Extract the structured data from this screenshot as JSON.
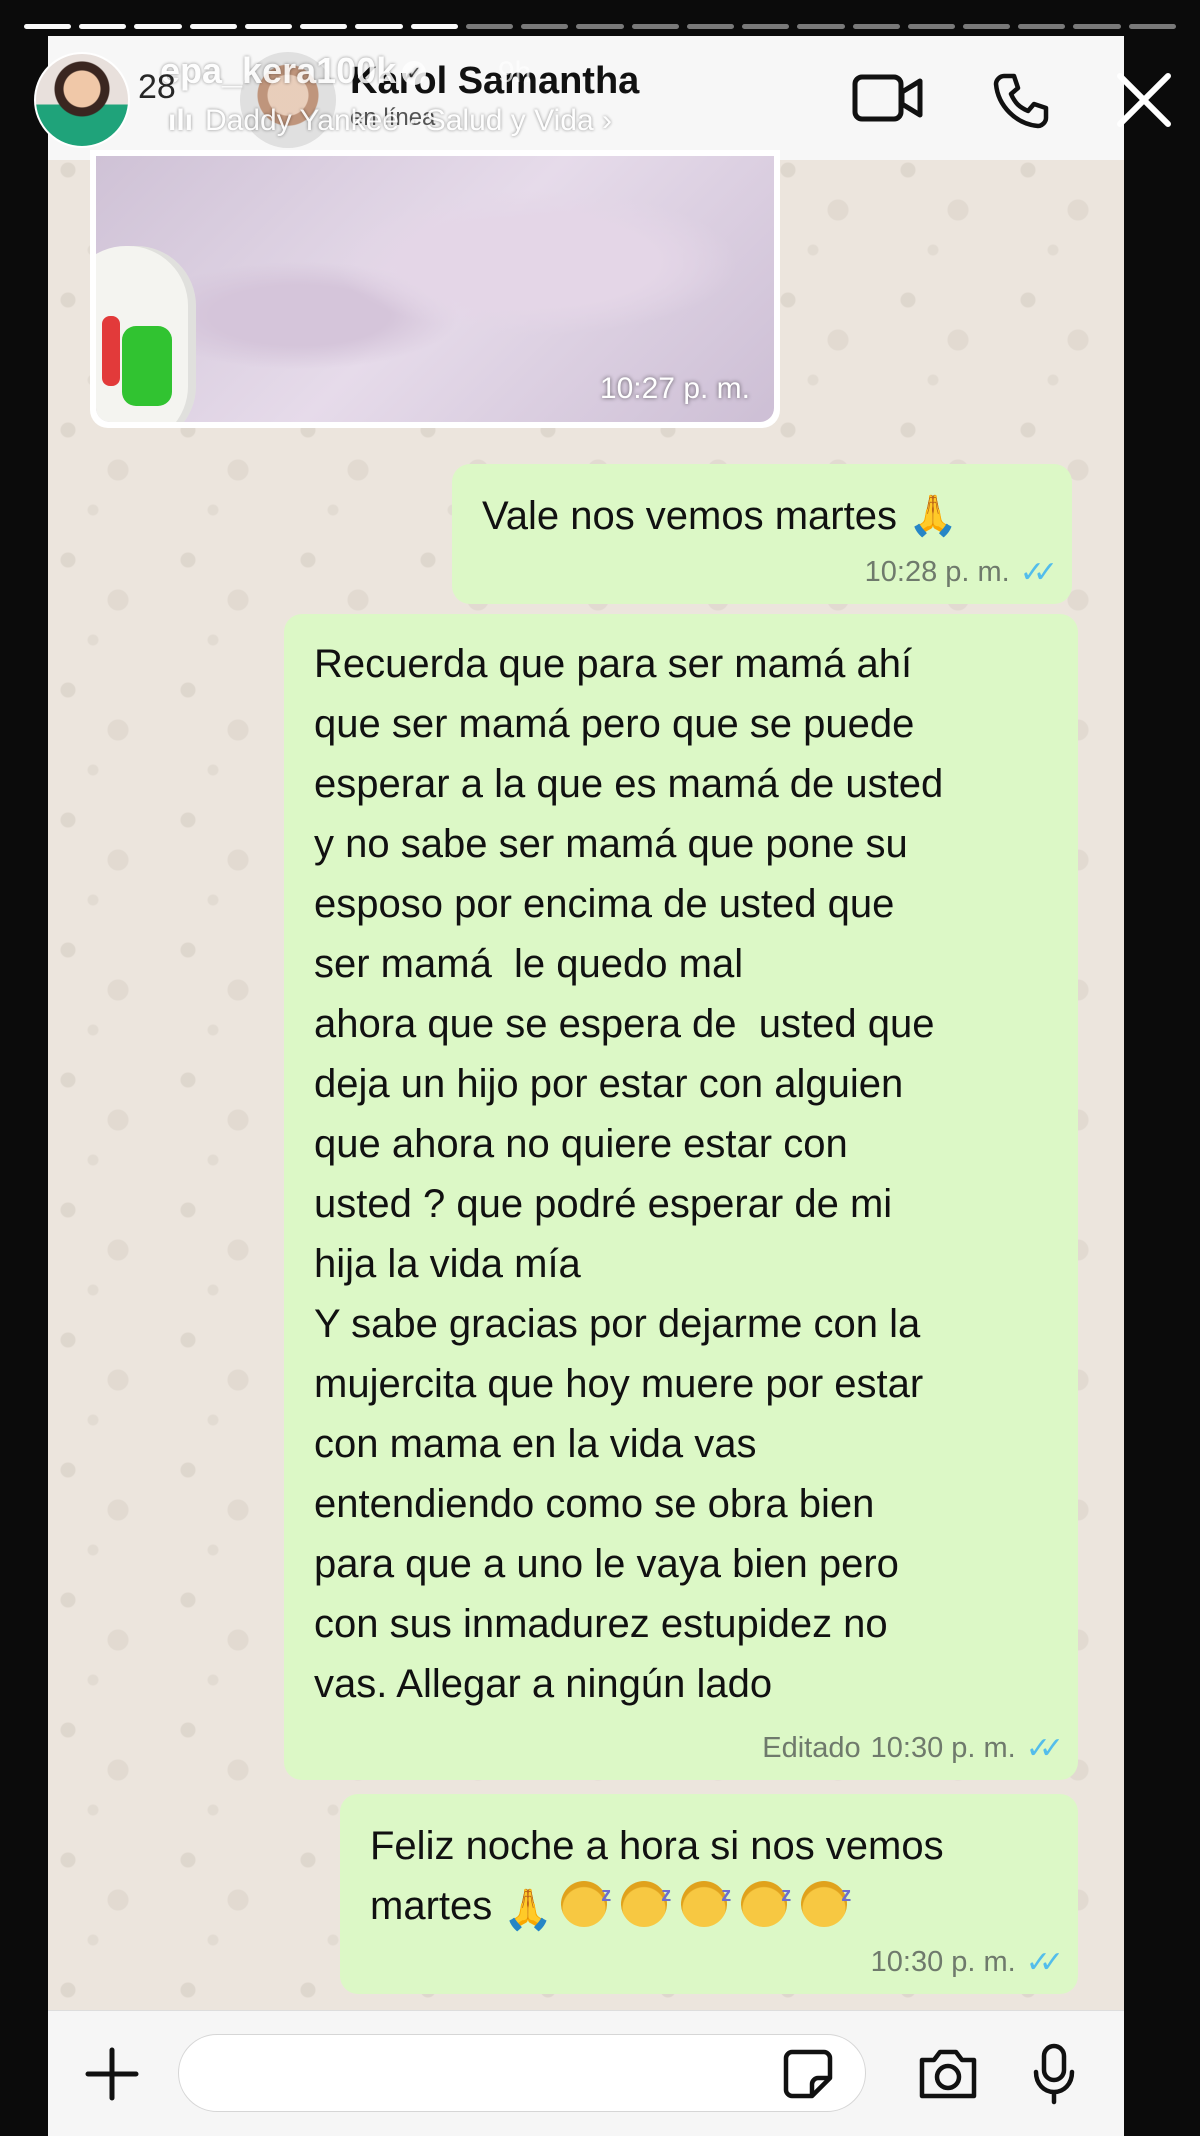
{
  "story": {
    "username": "epa_kera100k",
    "time": "9h",
    "music_prefix": "28",
    "music_artist": "Daddy Yankee",
    "music_song": "Salud y Vida"
  },
  "chat_header": {
    "contact_name": "Karol Samantha",
    "status": "en línea"
  },
  "messages": [
    {
      "type": "image",
      "time": "10:27 p. m."
    },
    {
      "type": "text",
      "text": "Vale nos vemos martes 🙏",
      "time": "10:28 p. m.",
      "edited": ""
    },
    {
      "type": "text",
      "text": "Recuerda que para ser mamá ahí\nque ser mamá pero que se puede\nesperar a la que es mamá de usted\ny no sabe ser mamá que pone su\nesposo por encima de usted que\nser mamá  le quedo mal\nahora que se espera de  usted que\ndeja un hijo por estar con alguien\nque ahora no quiere estar con\nusted ? que podré esperar de mi\nhija la vida mía\nY sabe gracias por dejarme con la\nmujercita que hoy muere por estar\ncon mama en la vida vas\nentendiendo como se obra bien\npara que a uno le vaya bien pero\ncon sus inmadurez estupidez no\nvas. Allegar a ningún lado",
      "time": "10:30 p. m.",
      "edited": "Editado"
    },
    {
      "type": "text",
      "line1": "Feliz noche a hora si nos vemos",
      "line2": "martes",
      "time": "10:30 p. m.",
      "edited": ""
    }
  ],
  "icons": {
    "video": "video-camera-icon",
    "call": "phone-icon",
    "close": "close-icon",
    "plus": "plus-icon",
    "sticker": "sticker-icon",
    "camera": "camera-icon",
    "mic": "microphone-icon"
  },
  "colors": {
    "outgoing_bubble": "#dcf8c6",
    "read_ticks": "#53bdeb",
    "chat_background": "#ece5dd"
  }
}
